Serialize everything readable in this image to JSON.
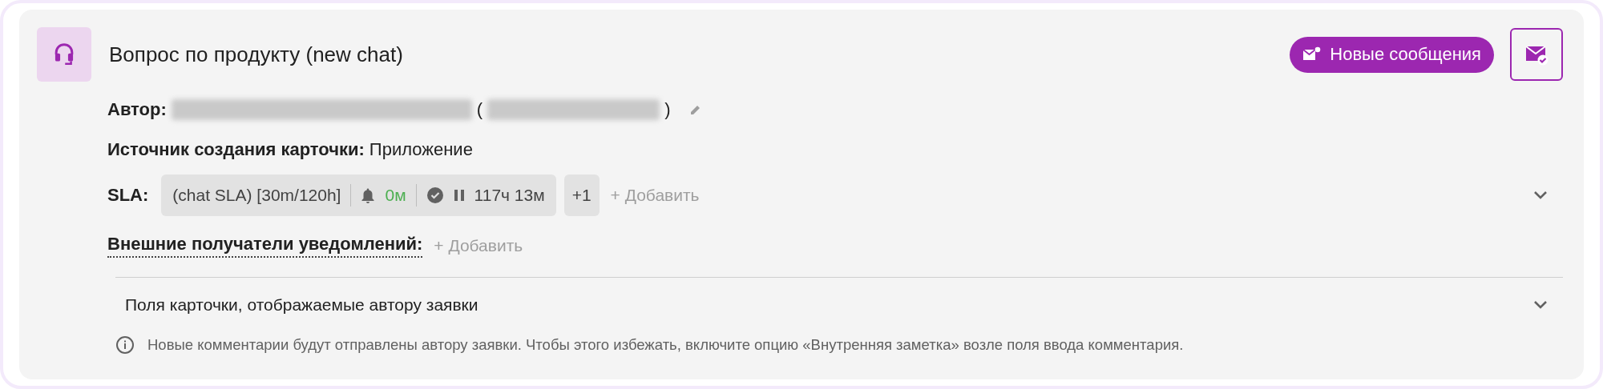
{
  "card": {
    "title": "Вопрос по продукту (new chat)"
  },
  "badge": {
    "label": "Новые сообщения"
  },
  "author": {
    "label": "Автор:",
    "open_paren": "(",
    "close_paren": ")"
  },
  "source": {
    "label": "Источник создания карточки:",
    "value": "Приложение"
  },
  "sla": {
    "label": "SLA:",
    "name": "(chat SLA) [30m/120h]",
    "reaction": "0м",
    "resolution": "117ч 13м",
    "paused": true,
    "extra": "+1",
    "add": "+ Добавить",
    "expanded": false
  },
  "recipients": {
    "label": "Внешние получатели уведомлений:",
    "add": "+ Добавить"
  },
  "fields_section": {
    "title": "Поля карточки, отображаемые автору заявки",
    "expanded": false
  },
  "notice": "Новые комментарии будут отправлены автору заявки. Чтобы этого избежать, включите опцию «Внутренняя заметка» возле поля ввода комментария."
}
